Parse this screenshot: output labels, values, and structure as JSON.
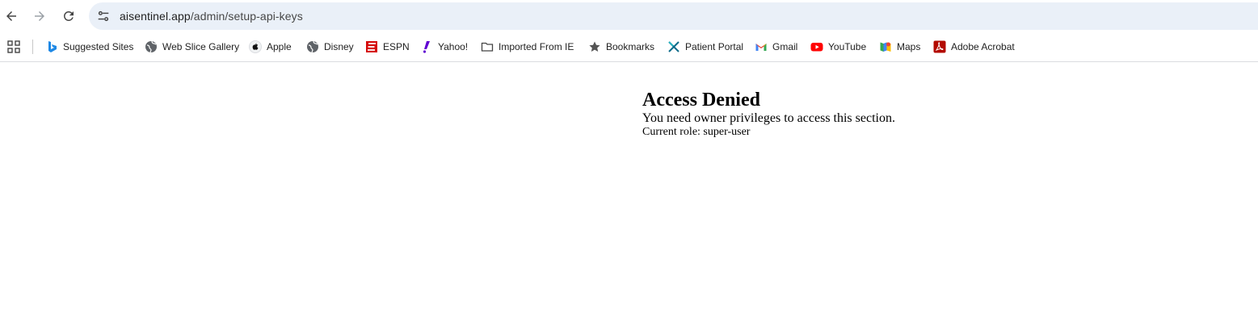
{
  "browser": {
    "url_domain": "aisentinel.app",
    "url_path": "/admin/setup-api-keys"
  },
  "bookmarks": [
    {
      "label": "Suggested Sites",
      "icon": "bing-icon"
    },
    {
      "label": "Web Slice Gallery",
      "icon": "globe-icon"
    },
    {
      "label": "Apple",
      "icon": "apple-icon"
    },
    {
      "label": "Disney",
      "icon": "globe-icon"
    },
    {
      "label": "ESPN",
      "icon": "espn-icon"
    },
    {
      "label": "Yahoo!",
      "icon": "yahoo-icon"
    },
    {
      "label": "Imported From IE",
      "icon": "folder-icon"
    },
    {
      "label": "Bookmarks",
      "icon": "star-icon"
    },
    {
      "label": "Patient Portal",
      "icon": "patient-portal-icon"
    },
    {
      "label": "Gmail",
      "icon": "gmail-icon"
    },
    {
      "label": "YouTube",
      "icon": "youtube-icon"
    },
    {
      "label": "Maps",
      "icon": "maps-icon"
    },
    {
      "label": "Adobe Acrobat",
      "icon": "acrobat-icon"
    }
  ],
  "page": {
    "heading": "Access Denied",
    "message": "You need owner privileges to access this section.",
    "role_text": "Current role: super-user"
  }
}
